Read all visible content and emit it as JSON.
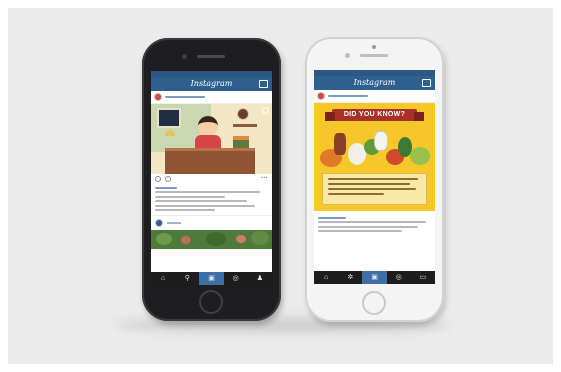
{
  "app": {
    "name": "Instagram"
  },
  "left_phone": {
    "tabs": [
      {
        "name": "home-icon",
        "glyph": "⌂"
      },
      {
        "name": "search-icon",
        "glyph": "⚲"
      },
      {
        "name": "camera-icon",
        "glyph": "▣"
      },
      {
        "name": "activity-icon",
        "glyph": "◎"
      },
      {
        "name": "profile-icon",
        "glyph": "♟"
      }
    ]
  },
  "right_phone": {
    "banner": "DID YOU KNOW?",
    "tabs": [
      {
        "name": "home-icon",
        "glyph": "⌂"
      },
      {
        "name": "explore-icon",
        "glyph": "✲"
      },
      {
        "name": "camera-icon",
        "glyph": "▣"
      },
      {
        "name": "activity-icon",
        "glyph": "◎"
      },
      {
        "name": "inbox-icon",
        "glyph": "▭"
      }
    ]
  },
  "colors": {
    "nav_blue": "#2f5f8f",
    "post_yellow": "#f5c72a",
    "banner_red": "#a8322a",
    "tab_active": "#3d6fa6"
  }
}
